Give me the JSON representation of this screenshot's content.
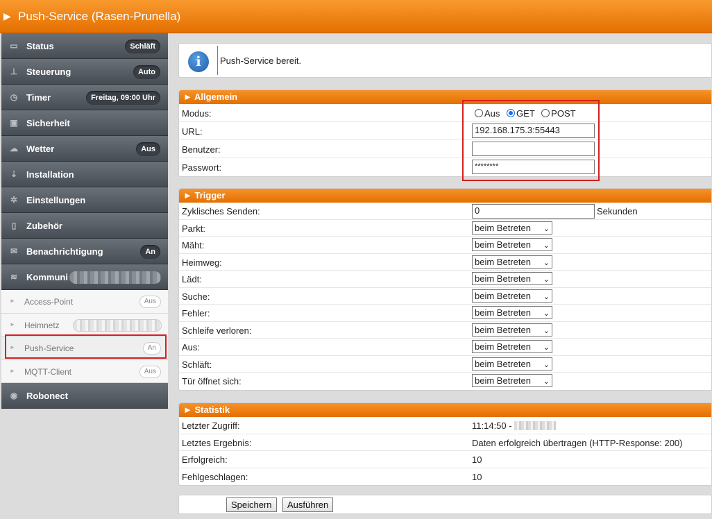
{
  "header": {
    "title": "Push-Service (Rasen-Prunella)"
  },
  "sidebar": {
    "items": [
      {
        "label": "Status",
        "icon": "chart-icon",
        "badge": "Schläft"
      },
      {
        "label": "Steuerung",
        "icon": "joystick-icon",
        "badge": "Auto"
      },
      {
        "label": "Timer",
        "icon": "clock-icon",
        "badge": "Freitag, 09:00 Uhr"
      },
      {
        "label": "Sicherheit",
        "icon": "lock-icon",
        "badge": ""
      },
      {
        "label": "Wetter",
        "icon": "weather-icon",
        "badge": "Aus"
      },
      {
        "label": "Installation",
        "icon": "install-icon",
        "badge": ""
      },
      {
        "label": "Einstellungen",
        "icon": "gear-icon",
        "badge": ""
      },
      {
        "label": "Zubehör",
        "icon": "accessory-icon",
        "badge": ""
      },
      {
        "label": "Benachrichtigung",
        "icon": "mail-icon",
        "badge": "An"
      },
      {
        "label": "Kommuni",
        "icon": "wifi-icon",
        "badge": ""
      }
    ],
    "subitems": [
      {
        "label": "Access-Point",
        "badge": "Aus"
      },
      {
        "label": "Heimnetz",
        "badge": ""
      },
      {
        "label": "Push-Service",
        "badge": "An"
      },
      {
        "label": "MQTT-Client",
        "badge": "Aus"
      }
    ],
    "footer_item": {
      "label": "Robonect",
      "icon": "robonect-icon"
    }
  },
  "info": {
    "message": "Push-Service bereit."
  },
  "allgemein": {
    "title": "► Allgemein",
    "modus_label": "Modus:",
    "modus_options": [
      "Aus",
      "GET",
      "POST"
    ],
    "modus_selected": "GET",
    "url_label": "URL:",
    "url_value": "192.168.175.3:55443",
    "user_label": "Benutzer:",
    "user_value": "",
    "password_label": "Passwort:",
    "password_value": "********"
  },
  "trigger": {
    "title": "► Trigger",
    "cyclic_label": "Zyklisches Senden:",
    "cyclic_value": "0",
    "cyclic_unit": "Sekunden",
    "rows": [
      {
        "label": "Parkt:",
        "value": "beim Betreten"
      },
      {
        "label": "Mäht:",
        "value": "beim Betreten"
      },
      {
        "label": "Heimweg:",
        "value": "beim Betreten"
      },
      {
        "label": "Lädt:",
        "value": "beim Betreten"
      },
      {
        "label": "Suche:",
        "value": "beim Betreten"
      },
      {
        "label": "Fehler:",
        "value": "beim Betreten"
      },
      {
        "label": "Schleife verloren:",
        "value": "beim Betreten"
      },
      {
        "label": "Aus:",
        "value": "beim Betreten"
      },
      {
        "label": "Schläft:",
        "value": "beim Betreten"
      },
      {
        "label": "Tür öffnet sich:",
        "value": "beim Betreten"
      }
    ]
  },
  "statistik": {
    "title": "► Statistik",
    "rows": [
      {
        "label": "Letzter Zugriff:",
        "value": "11:14:50 -"
      },
      {
        "label": "Letztes Ergebnis:",
        "value": "Daten erfolgreich übertragen (HTTP-Response: 200)"
      },
      {
        "label": "Erfolgreich:",
        "value": "10"
      },
      {
        "label": "Fehlgeschlagen:",
        "value": "10"
      }
    ]
  },
  "buttons": {
    "save": "Speichern",
    "execute": "Ausführen"
  },
  "colors": {
    "accent": "#f08a1c",
    "highlight": "#d32020",
    "sidebar": "#555b62"
  }
}
